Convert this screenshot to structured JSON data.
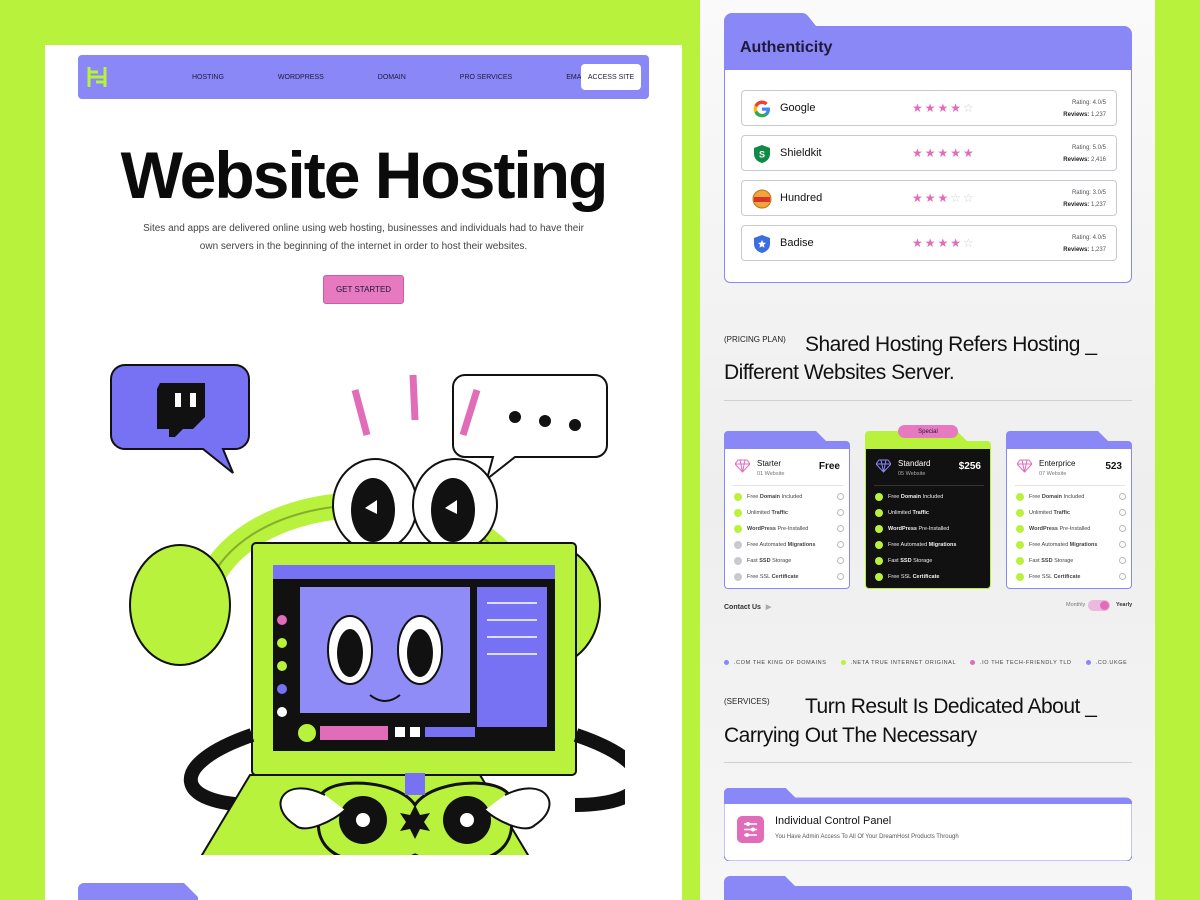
{
  "nav": {
    "links": [
      "HOSTING",
      "WORDPRESS",
      "DOMAIN",
      "PRO SERVICES",
      "EMAIL"
    ],
    "access_label": "ACCESS SITE"
  },
  "hero": {
    "title": "Website Hosting",
    "description": "Sites and apps are delivered online using web hosting, businesses and individuals had to have their own servers in the beginning of the internet in order to host their websites.",
    "cta_label": "GET STARTED"
  },
  "authenticity": {
    "title": "Authenticity",
    "reviews": [
      {
        "name": "Google",
        "stars": 4,
        "rating_label": "Rating:",
        "rating": "4.0/5",
        "reviews_label": "Reviews:",
        "reviews": "1,237"
      },
      {
        "name": "Shieldkit",
        "stars": 5,
        "rating_label": "Rating:",
        "rating": "5.0/5",
        "reviews_label": "Reviews:",
        "reviews": "2,416"
      },
      {
        "name": "Hundred",
        "stars": 3,
        "rating_label": "Rating:",
        "rating": "3.0/5",
        "reviews_label": "Reviews:",
        "reviews": "1,237"
      },
      {
        "name": "Badise",
        "stars": 4,
        "rating_label": "Rating:",
        "rating": "4.0/5",
        "reviews_label": "Reviews:",
        "reviews": "1,237"
      }
    ]
  },
  "pricing": {
    "tag": "(PRICING PLAN)",
    "title_line1": "Shared Hosting Refers Hosting _",
    "title_line2": "Different Websites Server.",
    "plans": [
      {
        "name": "Starter",
        "sub": "01 Website",
        "price": "Free"
      },
      {
        "name": "Standard",
        "sub": "05 Website",
        "price": "$256",
        "badge": "Special"
      },
      {
        "name": "Enterprice",
        "sub": "07 Website",
        "price": "523"
      }
    ],
    "features": [
      {
        "pre": "Free ",
        "bold": "Domain",
        "post": " Included"
      },
      {
        "pre": "Unlimited ",
        "bold": "Traffic",
        "post": ""
      },
      {
        "pre": "",
        "bold": "WordPress",
        "post": " Pre-Installed"
      },
      {
        "pre": "Free Automated ",
        "bold": "Migrations",
        "post": ""
      },
      {
        "pre": "Fast ",
        "bold": "SSD",
        "post": " Storage"
      },
      {
        "pre": "Free SSL ",
        "bold": "Certificate",
        "post": ""
      }
    ],
    "contact_label": "Contact Us",
    "toggle_monthly": "Monthly",
    "toggle_yearly": "Yearly"
  },
  "ticker": [
    {
      "text": ".COM THE KING OF DOMAINS",
      "color": "#8a87f7"
    },
    {
      "text": ".NETA TRUE INTERNET ORIGINAL",
      "color": "#b8f23c"
    },
    {
      "text": ".IO THE TECH-FRIENDLY TLD",
      "color": "#e16cb8"
    },
    {
      "text": ".CO.UKGE",
      "color": "#8a87f7"
    }
  ],
  "services": {
    "tag": "(SERVICES)",
    "title_line1": "Turn Result Is Dedicated About _",
    "title_line2": "Carrying Out The Necessary",
    "card_title": "Individual Control Panel",
    "card_desc": "You Have Admin Access To All Of Your DreamHost Products Through"
  },
  "colors": {
    "accent_purple": "#8a87f7",
    "accent_lime": "#b8f23c",
    "accent_pink": "#e16cb8"
  }
}
